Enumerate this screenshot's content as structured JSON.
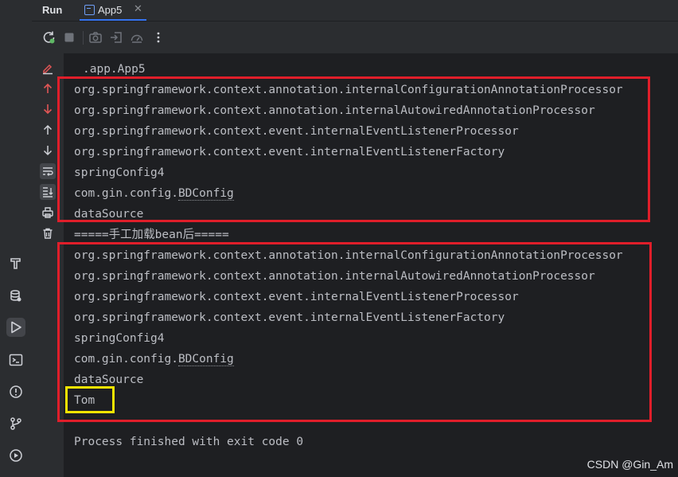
{
  "header": {
    "run_title": "Run",
    "tab_label": "App5",
    "tab_close": "✕"
  },
  "console": {
    "cut_line": "                                                                                          ",
    "class_line": ".app.App5",
    "before_lines": [
      "org.springframework.context.annotation.internalConfigurationAnnotationProcessor",
      "org.springframework.context.annotation.internalAutowiredAnnotationProcessor",
      "org.springframework.context.event.internalEventListenerProcessor",
      "org.springframework.context.event.internalEventListenerFactory",
      "springConfig4",
      "com.gin.config.",
      "dataSource"
    ],
    "bdconfig": "BDConfig",
    "separator": "=====手工加载bean后=====",
    "after_lines": [
      "org.springframework.context.annotation.internalConfigurationAnnotationProcessor",
      "org.springframework.context.annotation.internalAutowiredAnnotationProcessor",
      "org.springframework.context.event.internalEventListenerProcessor",
      "org.springframework.context.event.internalEventListenerFactory",
      "springConfig4",
      "com.gin.config.",
      "dataSource",
      "Tom"
    ],
    "exit_line": "Process finished with exit code 0"
  },
  "watermark": "CSDN @Gin_Am",
  "colors": {
    "highlight_red": "#e01e2a",
    "highlight_yellow": "#f5e400",
    "accent_blue": "#3574f0",
    "scroll_arrow_red": "#e05555"
  }
}
